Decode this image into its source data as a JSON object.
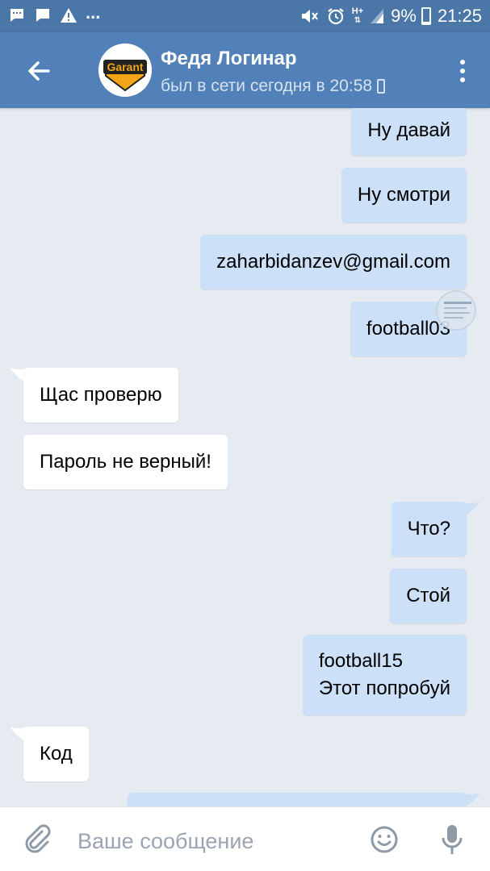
{
  "status_bar": {
    "time": "21:25",
    "battery": "9%",
    "battery_level": 0.09,
    "network": "H+",
    "overflow_indicator": "...",
    "icons": [
      "sms-icon",
      "chat-bubble-icon",
      "warning-icon",
      "mute-icon",
      "alarm-icon",
      "signal-icon",
      "battery-icon"
    ]
  },
  "header": {
    "contact_name": "Федя Логинар",
    "last_seen": "был в сети сегодня в 20:58",
    "avatar_text": "Garant",
    "colors": {
      "bar": "#5181b8",
      "status_bar": "#4a76a8"
    }
  },
  "messages": [
    {
      "direction": "out",
      "text": "Ну давай"
    },
    {
      "direction": "out",
      "text": "Ну смотри"
    },
    {
      "direction": "out",
      "text": "zaharbidanzev@gmail.com"
    },
    {
      "direction": "out",
      "text": "football03"
    },
    {
      "direction": "in",
      "text": "Щас проверю"
    },
    {
      "direction": "in",
      "text": "Пароль не верный!"
    },
    {
      "direction": "out",
      "text": "Что?"
    },
    {
      "direction": "out",
      "text": "Стой"
    },
    {
      "direction": "out",
      "text": "football15\nЭтот попробуй"
    },
    {
      "direction": "in",
      "text": "Код"
    },
    {
      "direction": "out",
      "text": ""
    }
  ],
  "composer": {
    "placeholder": "Ваше сообщение",
    "value": ""
  },
  "colors": {
    "background": "#e6ebf1",
    "outgoing_bubble": "#cce0f8",
    "incoming_bubble": "#ffffff"
  }
}
